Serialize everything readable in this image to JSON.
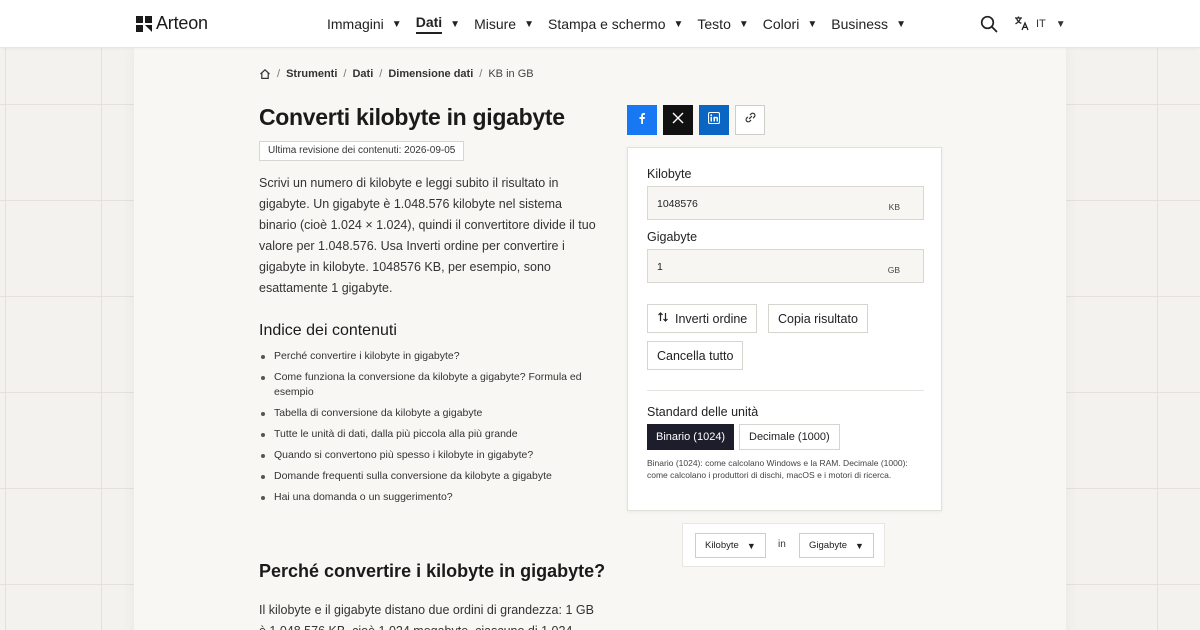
{
  "brand": {
    "name": "Arteon"
  },
  "nav": {
    "items": [
      {
        "label": "Immagini",
        "active": false
      },
      {
        "label": "Dati",
        "active": true
      },
      {
        "label": "Misure",
        "active": false
      },
      {
        "label": "Stampa e schermo",
        "active": false
      },
      {
        "label": "Testo",
        "active": false
      },
      {
        "label": "Colori",
        "active": false
      },
      {
        "label": "Business",
        "active": false
      }
    ],
    "language": "IT",
    "caret": "▼"
  },
  "breadcrumb": {
    "items": [
      "Strumenti",
      "Dati",
      "Dimensione dati"
    ],
    "current": "KB in GB",
    "separator": "/"
  },
  "page": {
    "title": "Converti kilobyte in gigabyte",
    "revision": "Ultima revisione dei contenuti: 2026-09-05",
    "intro": "Scrivi un numero di kilobyte e leggi subito il risultato in gigabyte. Un gigabyte è 1.048.576 kilobyte nel sistema binario (cioè 1.024 × 1.024), quindi il convertitore divide il tuo valore per 1.048.576. Usa Inverti ordine per convertire i gigabyte in kilobyte. 1048576 KB, per esempio, sono esattamente 1 gigabyte."
  },
  "toc": {
    "title": "Indice dei contenuti",
    "items": [
      "Perché convertire i kilobyte in gigabyte?",
      "Come funziona la conversione da kilobyte a gigabyte? Formula ed esempio",
      "Tabella di conversione da kilobyte a gigabyte",
      "Tutte le unità di dati, dalla più piccola alla più grande",
      "Quando si convertono più spesso i kilobyte in gigabyte?",
      "Domande frequenti sulla conversione da kilobyte a gigabyte",
      "Hai una domanda o un suggerimento?"
    ]
  },
  "section": {
    "title": "Perché convertire i kilobyte in gigabyte?",
    "text": "Il kilobyte e il gigabyte distano due ordini di grandezza: 1 GB è 1.048.576 KB, cioè 1.024 megabyte, ciascuno di 1.024"
  },
  "share": {
    "buttons": [
      "facebook-icon",
      "x-icon",
      "linkedin-icon",
      "link-icon"
    ],
    "colors": {
      "facebook": "#1877f2",
      "x": "#111111",
      "linkedin": "#0a66c2"
    }
  },
  "converter": {
    "from_label": "Kilobyte",
    "from_value": "1048576",
    "from_unit": "KB",
    "to_label": "Gigabyte",
    "to_value": "1",
    "to_unit": "GB",
    "swap_label": "Inverti ordine",
    "copy_label": "Copia risultato",
    "clear_label": "Cancella tutto",
    "standard_label": "Standard delle unità",
    "binary_label": "Binario (1024)",
    "decimal_label": "Decimale (1000)",
    "selected_standard": "Binario (1024)",
    "note": "Binario (1024): come calcolano Windows e la RAM. Decimale (1000): come calcolano i produttori di dischi, macOS e i motori di ricerca."
  },
  "unit_selector": {
    "from": "Kilobyte",
    "connector": "in",
    "to": "Gigabyte"
  }
}
